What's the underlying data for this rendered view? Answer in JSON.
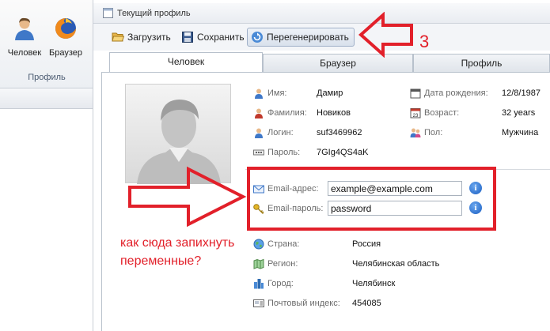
{
  "ribbon": {
    "buttons": [
      {
        "label": "Человек",
        "icon": "person-icon"
      },
      {
        "label": "Браузер",
        "icon": "firefox-icon"
      }
    ],
    "group_label": "Профиль"
  },
  "panel": {
    "title": "Текущий профиль"
  },
  "toolbar": {
    "load": "Загрузить",
    "save": "Сохранить",
    "regenerate": "Перегенерировать"
  },
  "tabs": [
    "Человек",
    "Браузер",
    "Профиль"
  ],
  "person": {
    "name_label": "Имя:",
    "name": "Дамир",
    "surname_label": "Фамилия:",
    "surname": "Новиков",
    "login_label": "Логин:",
    "login": "suf3469962",
    "password_label": "Пароль:",
    "password": "7GIg4QS4aK",
    "birth_label": "Дата рождения:",
    "birth": "12/8/1987",
    "age_label": "Возраст:",
    "age": "32 years",
    "gender_label": "Пол:",
    "gender": "Мужчина"
  },
  "email": {
    "address_label": "Email-адрес:",
    "address": "example@example.com",
    "password_label": "Email-пароль:",
    "password": "password"
  },
  "location": {
    "country_label": "Страна:",
    "country": "Россия",
    "region_label": "Регион:",
    "region": "Челябинская область",
    "city_label": "Город:",
    "city": "Челябинск",
    "zip_label": "Почтовый индекс:",
    "zip": "454085"
  },
  "annotation": {
    "number": "3",
    "line1": "как сюда запихнуть",
    "line2": "переменные?",
    "color": "#e2202a"
  }
}
